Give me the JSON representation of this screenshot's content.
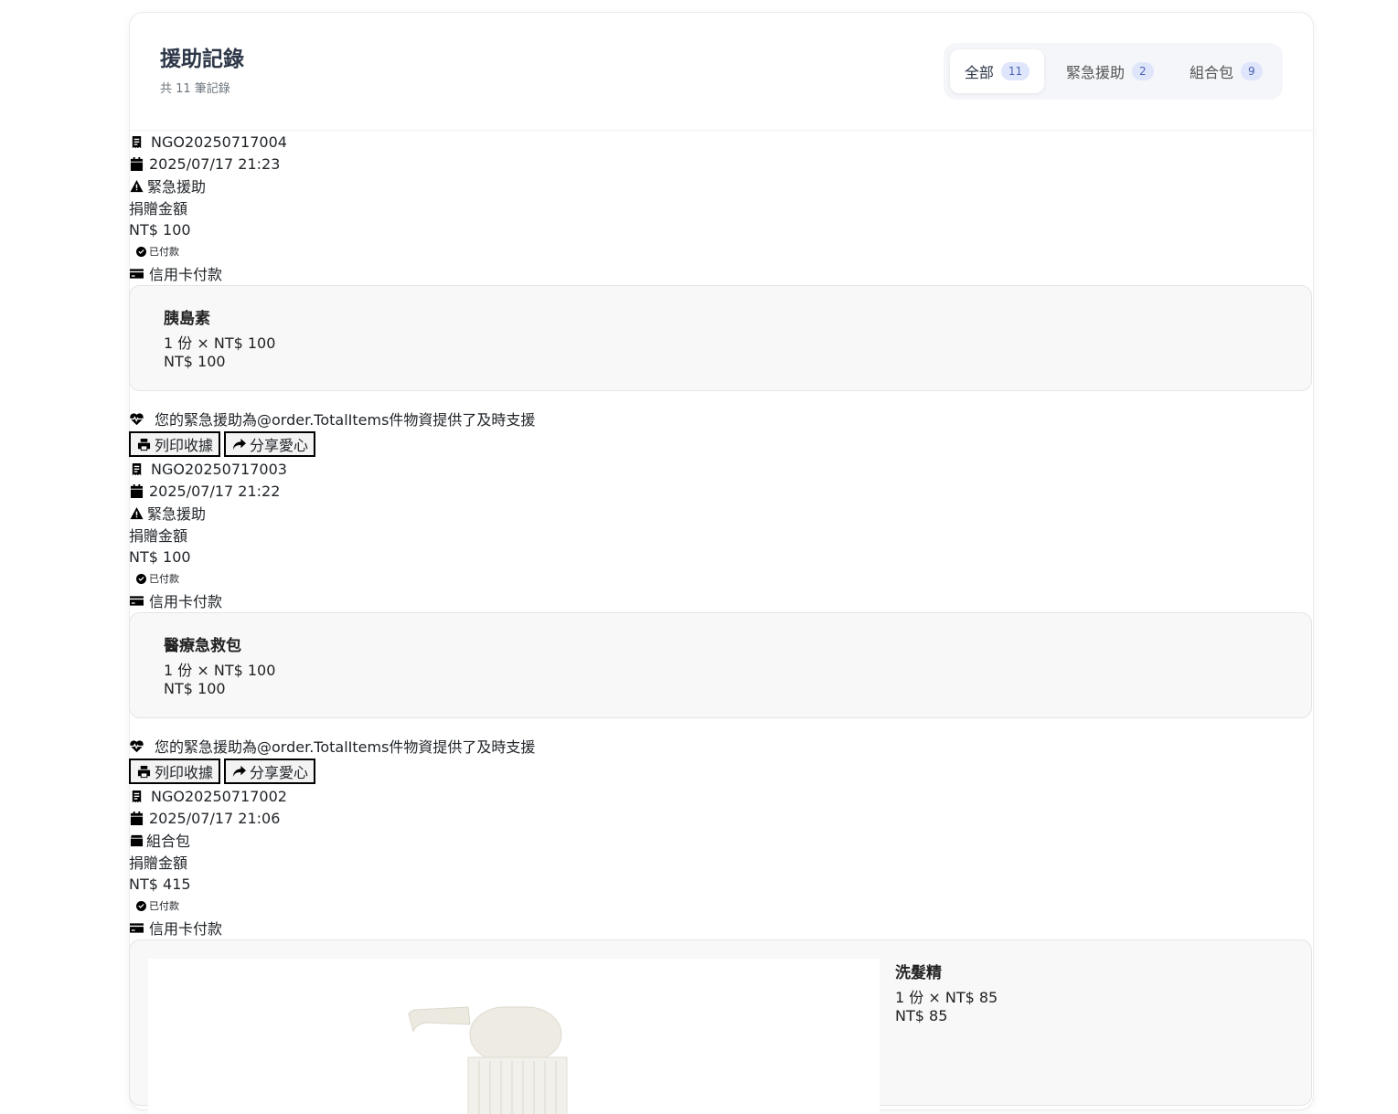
{
  "header": {
    "title": "援助記錄",
    "subtitle": "共 11 筆記錄"
  },
  "tabs": [
    {
      "label": "全部",
      "count": "11"
    },
    {
      "label": "緊急援助",
      "count": "2"
    },
    {
      "label": "組合包",
      "count": "9"
    }
  ],
  "orders": [
    {
      "order_no": "NGO20250717004",
      "date": "2025/07/17 21:23",
      "type": "緊急援助",
      "amount_label": "捐贈金額",
      "amount": "NT$ 100",
      "status": "已付款",
      "payment": "信用卡付款",
      "item": {
        "name": "胰島素",
        "qty": "1 份 × NT$ 100",
        "subtotal": "NT$ 100"
      },
      "message": "您的緊急援助為@order.TotalItems件物資提供了及時支援",
      "print_label": "列印收據",
      "share_label": "分享愛心"
    },
    {
      "order_no": "NGO20250717003",
      "date": "2025/07/17 21:22",
      "type": "緊急援助",
      "amount_label": "捐贈金額",
      "amount": "NT$ 100",
      "status": "已付款",
      "payment": "信用卡付款",
      "item": {
        "name": "醫療急救包",
        "qty": "1 份 × NT$ 100",
        "subtotal": "NT$ 100"
      },
      "message": "您的緊急援助為@order.TotalItems件物資提供了及時支援",
      "print_label": "列印收據",
      "share_label": "分享愛心"
    },
    {
      "order_no": "NGO20250717002",
      "date": "2025/07/17 21:06",
      "type": "組合包",
      "amount_label": "捐贈金額",
      "amount": "NT$ 415",
      "status": "已付款",
      "payment": "信用卡付款",
      "item": {
        "name": "洗髮精",
        "qty": "1 份 × NT$ 85",
        "subtotal": "NT$ 85"
      }
    }
  ]
}
